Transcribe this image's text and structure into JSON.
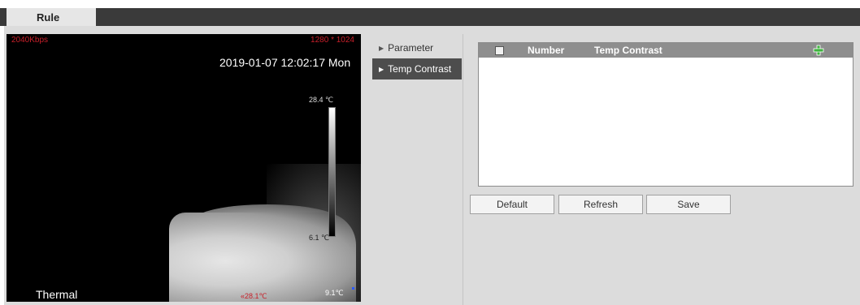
{
  "tabs": {
    "active_label": "Rule"
  },
  "video": {
    "bitrate": "2040Kbps",
    "resolution": "1280 * 1024",
    "timestamp": "2019-01-07 12:02:17 Mon",
    "temp_max": "28.4 ℃",
    "temp_min": "6.1 ℃",
    "temp_corner": "9.1℃",
    "center_mark": "«28.1℃",
    "channel_label": "Thermal"
  },
  "menu": {
    "items": [
      {
        "label": "Parameter",
        "active": false
      },
      {
        "label": "Temp Contrast",
        "active": true
      }
    ]
  },
  "table": {
    "columns": [
      "Number",
      "Temp Contrast"
    ],
    "rows": []
  },
  "buttons": {
    "default_label": "Default",
    "refresh_label": "Refresh",
    "save_label": "Save"
  },
  "icons": {
    "menu_arrow": "triangle-right-icon",
    "add": "plus-icon"
  },
  "colors": {
    "tabbar": "#3a3a3a",
    "panel_bg": "#dcdcdc",
    "table_header": "#8e8e8e",
    "active_menu": "#4d4d4d",
    "osd_red": "#c8202a",
    "add_icon_green": "#3fb33f"
  }
}
